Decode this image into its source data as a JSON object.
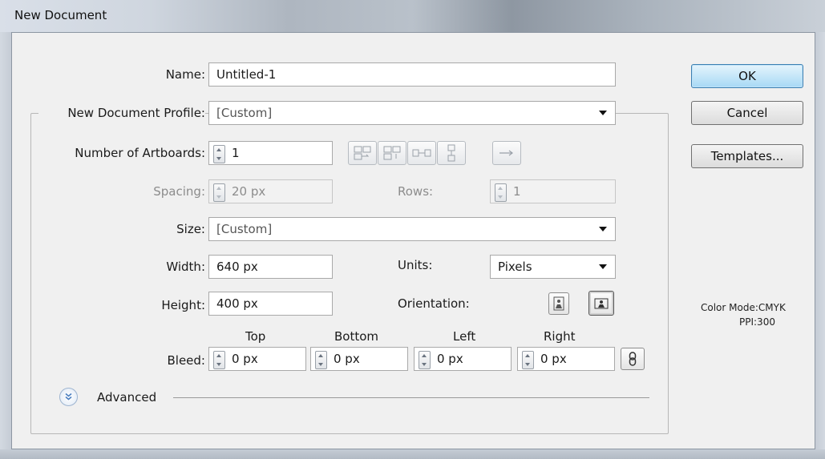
{
  "window": {
    "title": "New Document"
  },
  "form": {
    "name_label": "Name:",
    "name_value": "Untitled-1",
    "profile_label": "New Document Profile:",
    "profile_value": "[Custom]",
    "artboards_label": "Number of Artboards:",
    "artboards_value": "1",
    "spacing_label": "Spacing:",
    "spacing_value": "20 px",
    "rows_label": "Rows:",
    "rows_value": "1",
    "size_label": "Size:",
    "size_value": "[Custom]",
    "width_label": "Width:",
    "width_value": "640 px",
    "units_label": "Units:",
    "units_value": "Pixels",
    "height_label": "Height:",
    "height_value": "400 px",
    "orientation_label": "Orientation:",
    "bleed_label": "Bleed:",
    "bleed": {
      "top_label": "Top",
      "top_value": "0 px",
      "bottom_label": "Bottom",
      "bottom_value": "0 px",
      "left_label": "Left",
      "left_value": "0 px",
      "right_label": "Right",
      "right_value": "0 px"
    },
    "advanced_label": "Advanced"
  },
  "buttons": {
    "ok": "OK",
    "cancel": "Cancel",
    "templates": "Templates..."
  },
  "info": {
    "color_mode": "Color Mode:CMYK",
    "ppi": "PPI:300"
  },
  "artboard_layout_icons": [
    "grid-by-row-icon",
    "grid-by-column-icon",
    "arrange-by-row-icon",
    "arrange-by-column-icon"
  ],
  "layout_direction_icon": "right-to-left-arrow-icon",
  "colors": {
    "default_button": "#a7d9f5",
    "dialog_bg": "#f0f0f0",
    "advanced_toggle": "#4a7fc0"
  }
}
